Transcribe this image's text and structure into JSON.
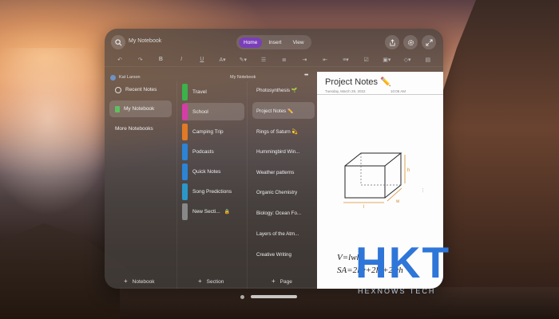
{
  "window": {
    "notebook_title": "My Notebook",
    "tabs": [
      {
        "label": "Home",
        "active": true
      },
      {
        "label": "Insert",
        "active": false
      },
      {
        "label": "View",
        "active": false
      }
    ],
    "toolbar_icons": [
      "undo-icon",
      "redo-icon",
      "bold-icon",
      "italic-icon",
      "underline-icon",
      "text-color-icon",
      "highlight-icon",
      "bullets-icon",
      "numbering-icon",
      "indent-icon",
      "outdent-icon",
      "align-icon",
      "checkbox-icon",
      "image-icon",
      "draw-icon",
      "sticky-note-icon"
    ],
    "top_right_icons": [
      "share-icon",
      "settings-icon",
      "expand-icon"
    ],
    "accent_color": "#7a3fb8"
  },
  "user": {
    "name": "Kat Larson",
    "notebook_label": "My Notebook",
    "more": "•••"
  },
  "nav": {
    "items": [
      {
        "label": "Recent Notes",
        "icon": "clock-icon",
        "active": false
      },
      {
        "label": "My Notebook",
        "icon": "notebook-icon",
        "active": true
      },
      {
        "label": "More Notebooks",
        "icon": "",
        "active": false
      }
    ],
    "add_label": "Notebook"
  },
  "sections": {
    "items": [
      {
        "label": "Travel",
        "color": "#3bb24a",
        "active": false
      },
      {
        "label": "School",
        "color": "#d63ca7",
        "active": true
      },
      {
        "label": "Camping Trip",
        "color": "#e07a26",
        "active": false
      },
      {
        "label": "Podcasts",
        "color": "#2b84d6",
        "active": false
      },
      {
        "label": "Quick Notes",
        "color": "#2b84d6",
        "active": false
      },
      {
        "label": "Song Predictions",
        "color": "#2b97c9",
        "active": false
      },
      {
        "label": "New Secti...",
        "color": "#888888",
        "active": false,
        "locked": true
      }
    ],
    "add_label": "Section"
  },
  "pages": {
    "items": [
      {
        "label": "Photosynthesis 🌱",
        "active": false
      },
      {
        "label": "Project Notes ✏️",
        "active": true
      },
      {
        "label": "Rings of Saturn 💫",
        "active": false
      },
      {
        "label": "Hummingbird Win...",
        "active": false
      },
      {
        "label": "Weather patterns",
        "active": false
      },
      {
        "label": "Organic Chemistry",
        "active": false
      },
      {
        "label": "Biology: Ocean Fo...",
        "active": false
      },
      {
        "label": "Layers of the Atm...",
        "active": false
      },
      {
        "label": "Creative Writing",
        "active": false
      }
    ],
    "add_label": "Page"
  },
  "note": {
    "title": "Project Notes ✏️",
    "date": "Tuesday, March 29, 2022",
    "time": "10:05 AM",
    "handwriting": [
      "V=lwh",
      "SA=2lw+2lh+2wh",
      "h",
      "l",
      "w"
    ]
  },
  "watermark": {
    "text": "HKT",
    "subtext": "HEXNOWS TECH"
  }
}
